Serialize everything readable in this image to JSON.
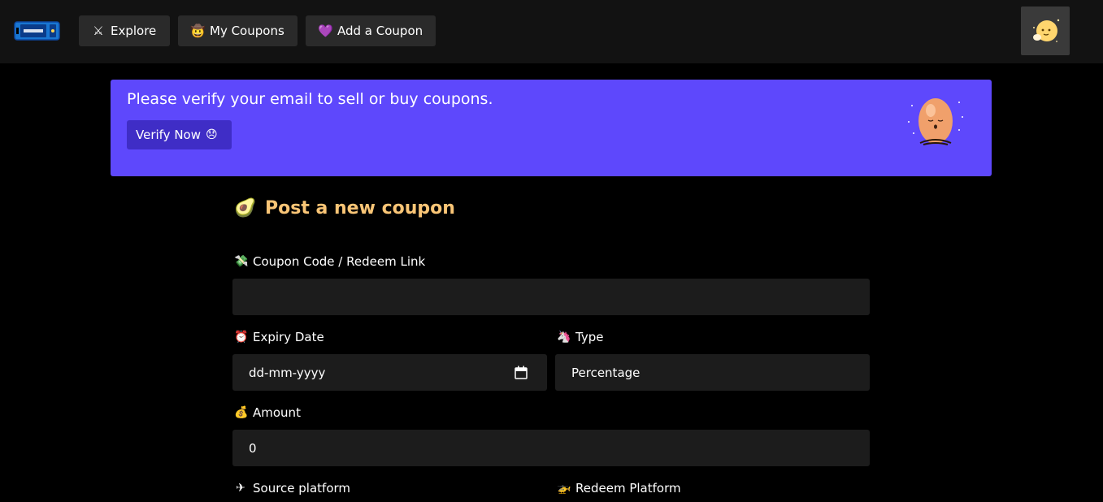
{
  "nav": {
    "items": [
      {
        "label": "Explore",
        "icon": "⚔"
      },
      {
        "label": "My Coupons",
        "icon": "🤠"
      },
      {
        "label": "Add a Coupon",
        "icon": "💜"
      }
    ]
  },
  "banner": {
    "message": "Please verify your email to sell or buy coupons.",
    "verify_label": "Verify Now",
    "verify_emoji": "😞",
    "background": "#5e48fc"
  },
  "form": {
    "title": "Post a new coupon",
    "title_icon": "🥑",
    "fields": {
      "code": {
        "label": "Coupon Code / Redeem Link",
        "icon": "💸",
        "value": ""
      },
      "expiry": {
        "label": "Expiry Date",
        "icon": "⏰",
        "value": "dd-mm-yyyy"
      },
      "type": {
        "label": "Type",
        "icon": "🦄",
        "value": "Percentage"
      },
      "amount": {
        "label": "Amount",
        "icon": "💰",
        "value": "0"
      },
      "source": {
        "label": "Source platform",
        "icon": "✈"
      },
      "redeem": {
        "label": "Redeem Platform",
        "icon": "🚁"
      }
    }
  },
  "colors": {
    "accent_title": "#f9c576",
    "navbar": "#121212",
    "input_bg": "#1c1c1c"
  }
}
